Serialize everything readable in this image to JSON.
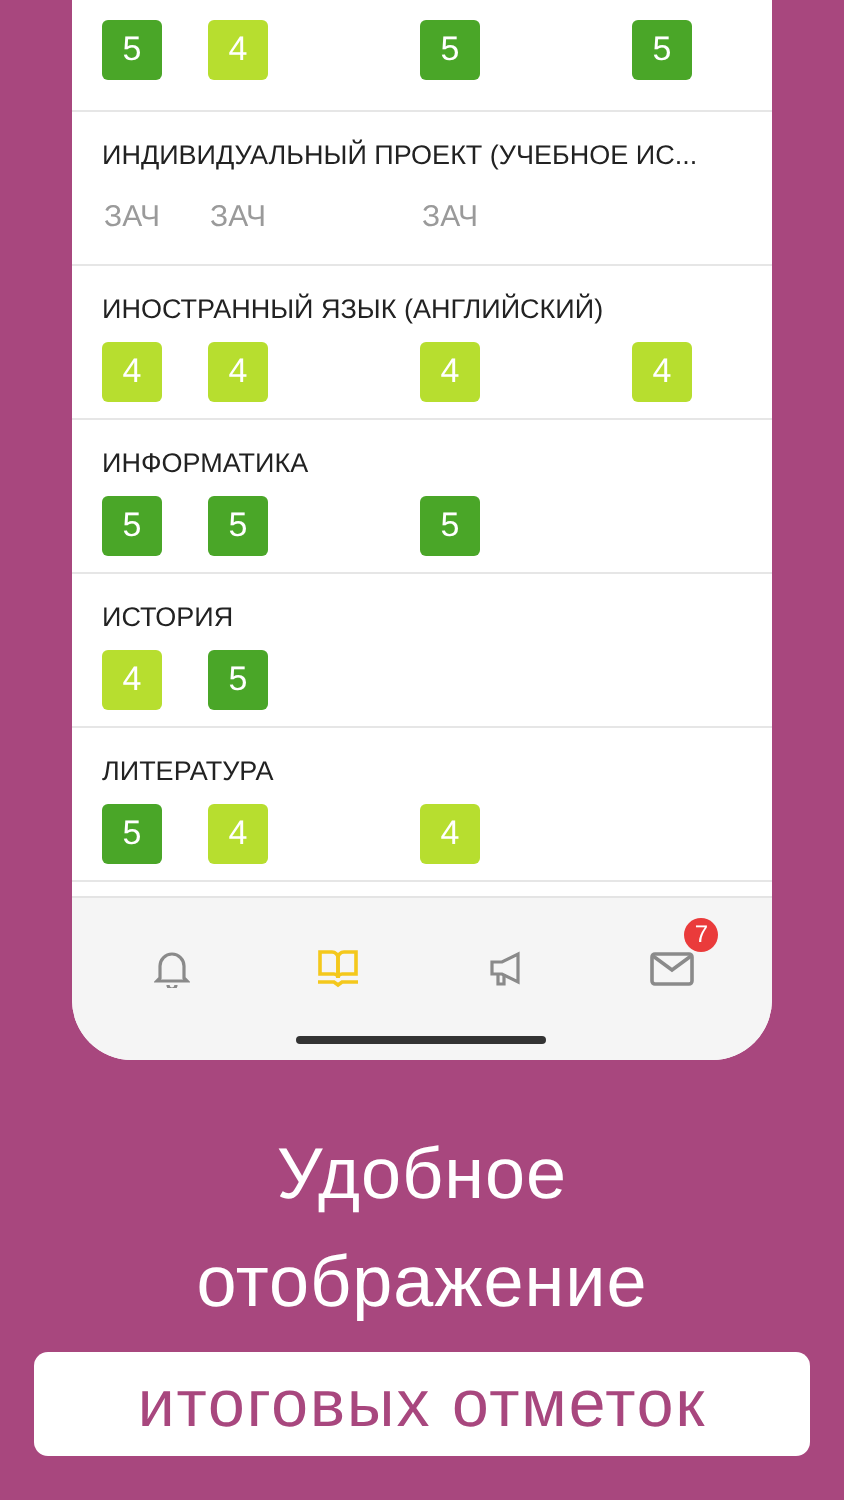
{
  "subjects": [
    {
      "grades": [
        {
          "text": "5",
          "kind": "mark",
          "color": "#4aa628"
        },
        {
          "text": "4",
          "kind": "mark",
          "color": "#b7de2f"
        },
        {
          "kind": "gap"
        },
        {
          "text": "5",
          "kind": "mark",
          "color": "#4aa628"
        },
        {
          "kind": "gap"
        },
        {
          "text": "5",
          "kind": "mark",
          "color": "#4aa628"
        }
      ]
    },
    {
      "title": "ИНДИВИДУАЛЬНЫЙ ПРОЕКТ (УЧЕБНОЕ ИС...",
      "grades": [
        {
          "text": "ЗАЧ",
          "kind": "pass"
        },
        {
          "text": "ЗАЧ",
          "kind": "pass"
        },
        {
          "kind": "gap"
        },
        {
          "text": "ЗАЧ",
          "kind": "pass"
        }
      ]
    },
    {
      "title": "ИНОСТРАННЫЙ ЯЗЫК (АНГЛИЙСКИЙ)",
      "grades": [
        {
          "text": "4",
          "kind": "mark",
          "color": "#b7de2f"
        },
        {
          "text": "4",
          "kind": "mark",
          "color": "#b7de2f"
        },
        {
          "kind": "gap"
        },
        {
          "text": "4",
          "kind": "mark",
          "color": "#b7de2f"
        },
        {
          "kind": "gap"
        },
        {
          "text": "4",
          "kind": "mark",
          "color": "#b7de2f"
        }
      ]
    },
    {
      "title": "ИНФОРМАТИКА",
      "grades": [
        {
          "text": "5",
          "kind": "mark",
          "color": "#4aa628"
        },
        {
          "text": "5",
          "kind": "mark",
          "color": "#4aa628"
        },
        {
          "kind": "gap"
        },
        {
          "text": "5",
          "kind": "mark",
          "color": "#4aa628"
        }
      ]
    },
    {
      "title": "ИСТОРИЯ",
      "grades": [
        {
          "text": "4",
          "kind": "mark",
          "color": "#b7de2f"
        },
        {
          "text": "5",
          "kind": "mark",
          "color": "#4aa628"
        }
      ]
    },
    {
      "title": "ЛИТЕРАТУРА",
      "grades": [
        {
          "text": "5",
          "kind": "mark",
          "color": "#4aa628"
        },
        {
          "text": "4",
          "kind": "mark",
          "color": "#b7de2f"
        },
        {
          "kind": "gap"
        },
        {
          "text": "4",
          "kind": "mark",
          "color": "#b7de2f"
        }
      ]
    }
  ],
  "tab_bar": [
    {
      "selected": false
    },
    {
      "selected": true
    },
    {
      "selected": false
    },
    {
      "selected": false,
      "badge": "7"
    }
  ],
  "caption": {
    "lines": [
      "Удобное",
      "отображение"
    ],
    "highlight": "итоговых отметок"
  }
}
